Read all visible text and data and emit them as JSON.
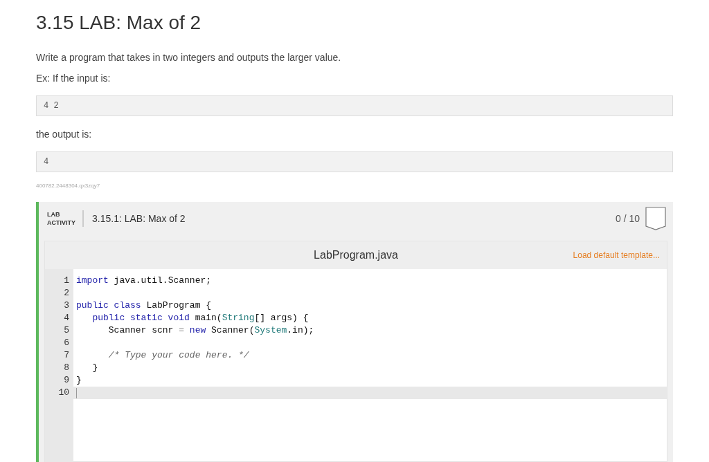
{
  "title": "3.15 LAB: Max of 2",
  "description": "Write a program that takes in two integers and outputs the larger value.",
  "example_intro": "Ex: If the input is:",
  "example_input": "4 2",
  "output_intro": "the output is:",
  "example_output": "4",
  "id_text": "400782.2448304.qx3zqy7",
  "lab": {
    "label_top": "LAB",
    "label_bottom": "ACTIVITY",
    "title": "3.15.1: LAB: Max of 2",
    "score": "0 / 10",
    "editor": {
      "filename": "LabProgram.java",
      "template_link": "Load default template...",
      "lines": [
        {
          "number": "1",
          "active": false,
          "tokens": [
            {
              "kind": "keyword",
              "text": "import"
            },
            {
              "kind": "plain",
              "text": " java.util.Scanner;"
            }
          ]
        },
        {
          "number": "2",
          "active": false
        },
        {
          "number": "3",
          "active": false,
          "tokens": [
            {
              "kind": "keyword",
              "text": "public class"
            },
            {
              "kind": "plain",
              "text": " LabProgram {"
            }
          ]
        },
        {
          "number": "4",
          "active": false,
          "tokens": [
            {
              "kind": "keyword",
              "text": "   public static void"
            },
            {
              "kind": "plain",
              "text": " main("
            },
            {
              "kind": "type",
              "text": "String"
            },
            {
              "kind": "plain",
              "text": "[] args) {"
            }
          ]
        },
        {
          "number": "5",
          "active": false,
          "tokens": [
            {
              "kind": "plain",
              "text": "      Scanner scnr "
            },
            {
              "kind": "operator",
              "text": "="
            },
            {
              "kind": "keyword",
              "text": " new"
            },
            {
              "kind": "plain",
              "text": " Scanner("
            },
            {
              "kind": "type",
              "text": "System"
            },
            {
              "kind": "plain",
              "text": ".in);"
            }
          ]
        },
        {
          "number": "6",
          "active": false
        },
        {
          "number": "7",
          "active": false,
          "tokens": [
            {
              "kind": "comment",
              "text": "      /* Type your code here. */"
            }
          ]
        },
        {
          "number": "8",
          "active": false,
          "tokens": [
            {
              "kind": "plain",
              "text": "   }"
            }
          ]
        },
        {
          "number": "9",
          "active": false,
          "tokens": [
            {
              "kind": "plain",
              "text": "}"
            }
          ]
        },
        {
          "number": "10",
          "active": true
        }
      ]
    }
  }
}
